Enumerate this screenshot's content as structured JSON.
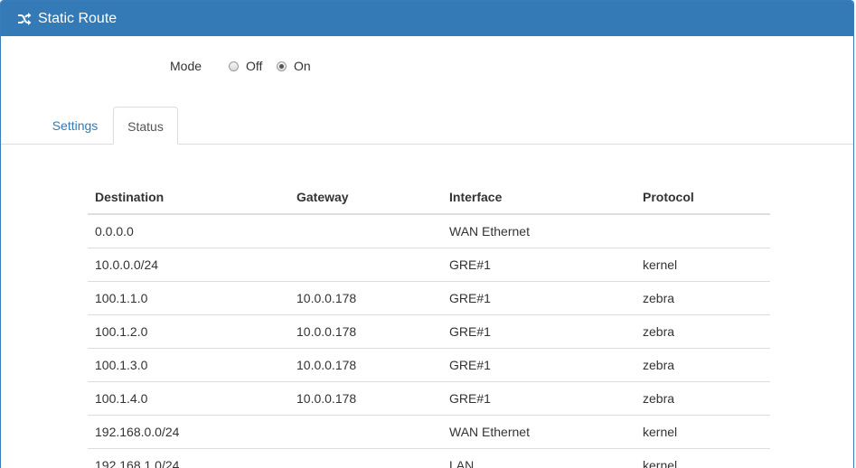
{
  "header": {
    "title": "Static Route",
    "icon": "shuffle-icon"
  },
  "mode": {
    "label": "Mode",
    "options": [
      {
        "label": "Off",
        "checked": false
      },
      {
        "label": "On",
        "checked": true
      }
    ]
  },
  "tabs": [
    {
      "label": "Settings",
      "active": false
    },
    {
      "label": "Status",
      "active": true
    }
  ],
  "table": {
    "columns": [
      "Destination",
      "Gateway",
      "Interface",
      "Protocol"
    ],
    "rows": [
      {
        "destination": "0.0.0.0",
        "gateway": "",
        "interface": "WAN Ethernet",
        "protocol": ""
      },
      {
        "destination": "10.0.0.0/24",
        "gateway": "",
        "interface": "GRE#1",
        "protocol": "kernel"
      },
      {
        "destination": "100.1.1.0",
        "gateway": "10.0.0.178",
        "interface": "GRE#1",
        "protocol": "zebra"
      },
      {
        "destination": "100.1.2.0",
        "gateway": "10.0.0.178",
        "interface": "GRE#1",
        "protocol": "zebra"
      },
      {
        "destination": "100.1.3.0",
        "gateway": "10.0.0.178",
        "interface": "GRE#1",
        "protocol": "zebra"
      },
      {
        "destination": "100.1.4.0",
        "gateway": "10.0.0.178",
        "interface": "GRE#1",
        "protocol": "zebra"
      },
      {
        "destination": "192.168.0.0/24",
        "gateway": "",
        "interface": "WAN Ethernet",
        "protocol": "kernel"
      },
      {
        "destination": "192.168.1.0/24",
        "gateway": "",
        "interface": "LAN",
        "protocol": "kernel"
      }
    ]
  },
  "colors": {
    "header_bg": "#337ab7",
    "link": "#337ab7",
    "border": "#dddddd"
  }
}
